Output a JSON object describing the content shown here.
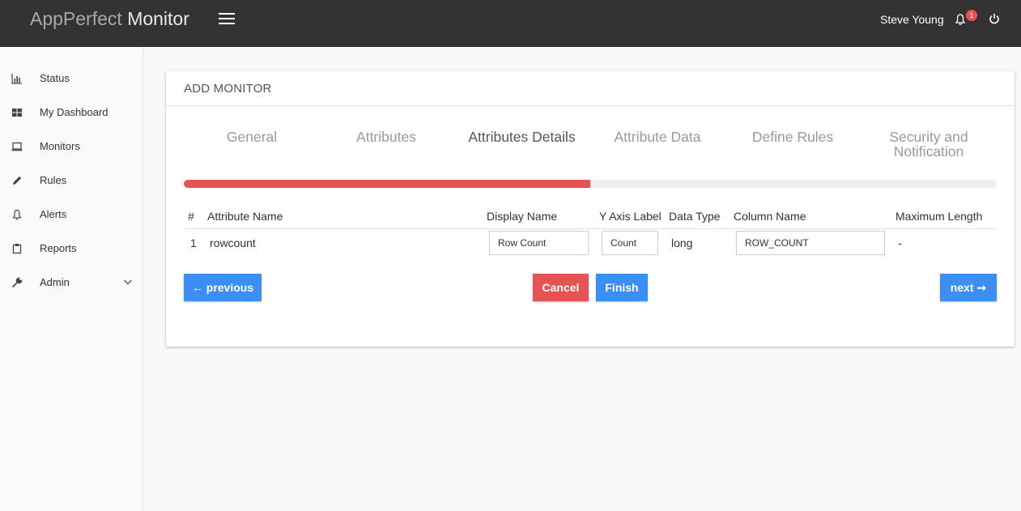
{
  "header": {
    "brand_light": "AppPerfect ",
    "brand_bold": "Monitor",
    "user_name": "Steve Young",
    "notification_count": "1"
  },
  "sidebar": {
    "items": [
      {
        "label": "Status",
        "icon": "bar-chart-icon"
      },
      {
        "label": "My Dashboard",
        "icon": "dashboard-grid-icon"
      },
      {
        "label": "Monitors",
        "icon": "monitor-icon"
      },
      {
        "label": "Rules",
        "icon": "pencil-icon"
      },
      {
        "label": "Alerts",
        "icon": "bell-icon"
      },
      {
        "label": "Reports",
        "icon": "clipboard-icon"
      },
      {
        "label": "Admin",
        "icon": "wrench-icon"
      }
    ]
  },
  "card": {
    "title": "ADD MONITOR",
    "steps": [
      "General",
      "Attributes",
      "Attributes Details",
      "Attribute Data",
      "Define Rules",
      "Security and Notification"
    ],
    "active_step": "Attributes Details",
    "progress_fraction": 0.5
  },
  "table": {
    "headers": [
      "#",
      "Attribute Name",
      "Display Name",
      "Y Axis Label",
      "Data Type",
      "Column Name",
      "Maximum Length"
    ],
    "rows": [
      {
        "index": "1",
        "attribute_name": "rowcount",
        "display_name": "Row Count",
        "y_axis_label": "Count",
        "data_type": "long",
        "column_name": "ROW_COUNT",
        "max_length": "-"
      }
    ]
  },
  "buttons": {
    "previous": "← previous",
    "cancel": "Cancel",
    "finish": "Finish",
    "next": "next ➞"
  },
  "colors": {
    "header_bg": "#333333",
    "accent_blue": "#3c8ef5",
    "accent_red": "#e55353"
  }
}
